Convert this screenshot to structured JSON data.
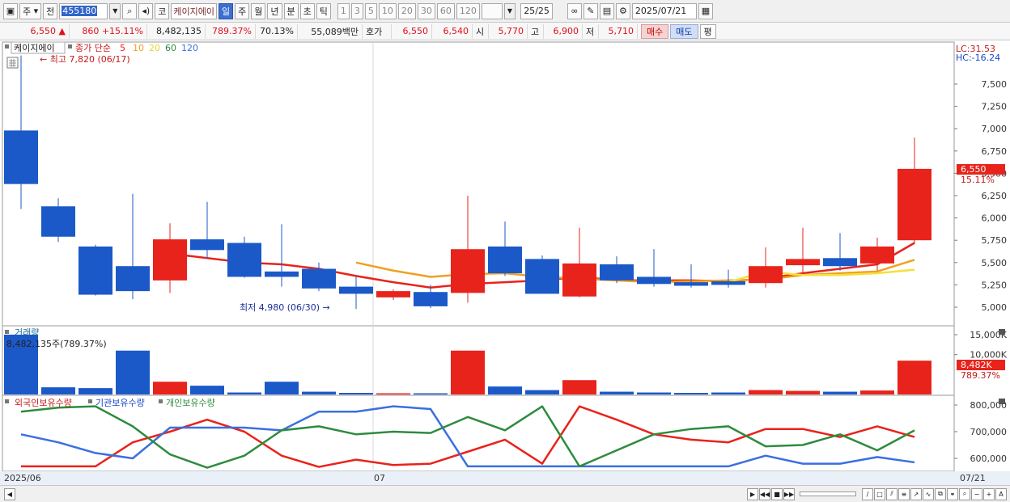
{
  "toolbar": {
    "market": "주",
    "prev": "전",
    "code": "455180",
    "code_type": "코",
    "stock_name": "케이지에이",
    "periods": [
      "일",
      "주",
      "월",
      "년",
      "분",
      "초",
      "틱"
    ],
    "selected_period": "일",
    "intervals": [
      "1",
      "3",
      "5",
      "10",
      "20",
      "30",
      "60",
      "120"
    ],
    "page": "25",
    "page_total": "/25",
    "date": "2025/07/21"
  },
  "quote": {
    "price": "6,550",
    "arrow": "▲",
    "change": "860",
    "change_pct": "+15.11%",
    "volume": "8,482,135",
    "vol_ratio": "789.37%",
    "turnover": "70.13%",
    "amount": "55,089백만",
    "ask_label": "호가",
    "ask1": "6,550",
    "ask2": "6,540",
    "open_label": "시",
    "open": "5,770",
    "high_label": "고",
    "high": "6,900",
    "low_label": "저",
    "low": "5,710",
    "buy": "매수",
    "sell": "매도",
    "eval": "평"
  },
  "price_panel": {
    "legend_name": "케이지에이",
    "legend_ma": "종가 단순",
    "ma_periods": [
      "5",
      "10",
      "20",
      "60",
      "120"
    ],
    "high_note": "최고 7,820 (06/17)",
    "low_note": "최저 4,980 (06/30)",
    "lc": "LC:31.53",
    "hc": "HC:-16.24",
    "price_tag": "6,550",
    "pct_tag": "15.11%",
    "y_ticks": [
      "7,500",
      "7,250",
      "7,000",
      "6,750",
      "6,500",
      "6,250",
      "6,000",
      "5,750",
      "5,500",
      "5,250",
      "5,000"
    ]
  },
  "volume_panel": {
    "title": "거래량",
    "info": "8,482,135주(789.37%)",
    "y_ticks": [
      "15,000K",
      "10,000K"
    ],
    "vol_tag": "8,482K",
    "vol_pct_tag": "789.37%"
  },
  "holdings_panel": {
    "legend": [
      "외국인보유수량",
      "기관보유수량",
      "개인보유수량"
    ],
    "y_ticks": [
      "800,000",
      "700,000",
      "600,000"
    ]
  },
  "x_axis": {
    "labels": [
      "2025/06",
      "07",
      "07/21"
    ]
  },
  "colors": {
    "up": "#e8231b",
    "down": "#1b59c8",
    "ma5": "#e8231b",
    "ma10": "#f0a020",
    "ma20": "#f2e23a",
    "ma60": "#2e8b3e",
    "ma120": "#3a6fe0"
  },
  "chart_data": {
    "type": "candlestick",
    "price_candles": [
      {
        "o": 6980,
        "h": 7820,
        "l": 6100,
        "c": 6380
      },
      {
        "o": 6130,
        "h": 6220,
        "l": 5730,
        "c": 5790
      },
      {
        "o": 5680,
        "h": 5700,
        "l": 5130,
        "c": 5140
      },
      {
        "o": 5460,
        "h": 6270,
        "l": 5090,
        "c": 5180
      },
      {
        "o": 5300,
        "h": 5940,
        "l": 5160,
        "c": 5760
      },
      {
        "o": 5760,
        "h": 6180,
        "l": 5540,
        "c": 5640
      },
      {
        "o": 5720,
        "h": 5790,
        "l": 5330,
        "c": 5340
      },
      {
        "o": 5400,
        "h": 5930,
        "l": 5230,
        "c": 5340
      },
      {
        "o": 5430,
        "h": 5500,
        "l": 5180,
        "c": 5210
      },
      {
        "o": 5230,
        "h": 5340,
        "l": 4980,
        "c": 5150
      },
      {
        "o": 5110,
        "h": 5200,
        "l": 5080,
        "c": 5180
      },
      {
        "o": 5170,
        "h": 5250,
        "l": 4990,
        "c": 5010
      },
      {
        "o": 5160,
        "h": 6250,
        "l": 5050,
        "c": 5650
      },
      {
        "o": 5680,
        "h": 5960,
        "l": 5350,
        "c": 5380
      },
      {
        "o": 5540,
        "h": 5580,
        "l": 5150,
        "c": 5150
      },
      {
        "o": 5120,
        "h": 5890,
        "l": 5110,
        "c": 5490
      },
      {
        "o": 5480,
        "h": 5570,
        "l": 5270,
        "c": 5300
      },
      {
        "o": 5340,
        "h": 5650,
        "l": 5230,
        "c": 5260
      },
      {
        "o": 5280,
        "h": 5480,
        "l": 5220,
        "c": 5240
      },
      {
        "o": 5290,
        "h": 5420,
        "l": 5220,
        "c": 5250
      },
      {
        "o": 5270,
        "h": 5670,
        "l": 5220,
        "c": 5460
      },
      {
        "o": 5470,
        "h": 5890,
        "l": 5380,
        "c": 5540
      },
      {
        "o": 5550,
        "h": 5830,
        "l": 5410,
        "c": 5460
      },
      {
        "o": 5490,
        "h": 5780,
        "l": 5410,
        "c": 5680
      },
      {
        "o": 5750,
        "h": 6900,
        "l": 5710,
        "c": 6550
      }
    ],
    "ma5": [
      null,
      null,
      null,
      null,
      5600,
      5550,
      5500,
      5480,
      5430,
      5350,
      5280,
      5220,
      5260,
      5280,
      5300,
      5340,
      5300,
      5300,
      5300,
      5290,
      5320,
      5380,
      5430,
      5480,
      5720
    ],
    "ma10": [
      null,
      null,
      null,
      null,
      null,
      null,
      null,
      null,
      null,
      5500,
      5410,
      5340,
      5370,
      5380,
      5340,
      5320,
      5300,
      5280,
      5290,
      5300,
      5310,
      5360,
      5380,
      5400,
      5530
    ],
    "ma20": [
      null,
      null,
      null,
      null,
      null,
      null,
      null,
      null,
      null,
      null,
      null,
      null,
      null,
      null,
      null,
      null,
      null,
      null,
      null,
      5280,
      5400,
      5360,
      5360,
      5380,
      5420
    ],
    "volume_k": [
      15000,
      1800,
      1600,
      11000,
      3200,
      2200,
      500,
      3200,
      700,
      400,
      300,
      300,
      11000,
      2000,
      1100,
      3600,
      700,
      500,
      400,
      500,
      1100,
      900,
      700,
      1000,
      8482
    ],
    "foreign": [
      570000,
      570000,
      570000,
      660000,
      700000,
      745000,
      700000,
      610000,
      568000,
      595000,
      575000,
      580000,
      625000,
      670000,
      580000,
      795000,
      745000,
      690000,
      670000,
      660000,
      710000,
      710000,
      680000,
      720000,
      680000
    ],
    "institution": [
      690000,
      660000,
      620000,
      600000,
      715000,
      715000,
      715000,
      705000,
      775000,
      775000,
      795000,
      785000,
      570000,
      570000,
      570000,
      570000,
      570000,
      570000,
      570000,
      570000,
      610000,
      580000,
      580000,
      605000,
      585000
    ],
    "individual": [
      775000,
      790000,
      795000,
      720000,
      615000,
      565000,
      610000,
      705000,
      720000,
      690000,
      700000,
      695000,
      755000,
      705000,
      795000,
      570000,
      630000,
      690000,
      710000,
      720000,
      645000,
      650000,
      690000,
      630000,
      705000
    ]
  }
}
